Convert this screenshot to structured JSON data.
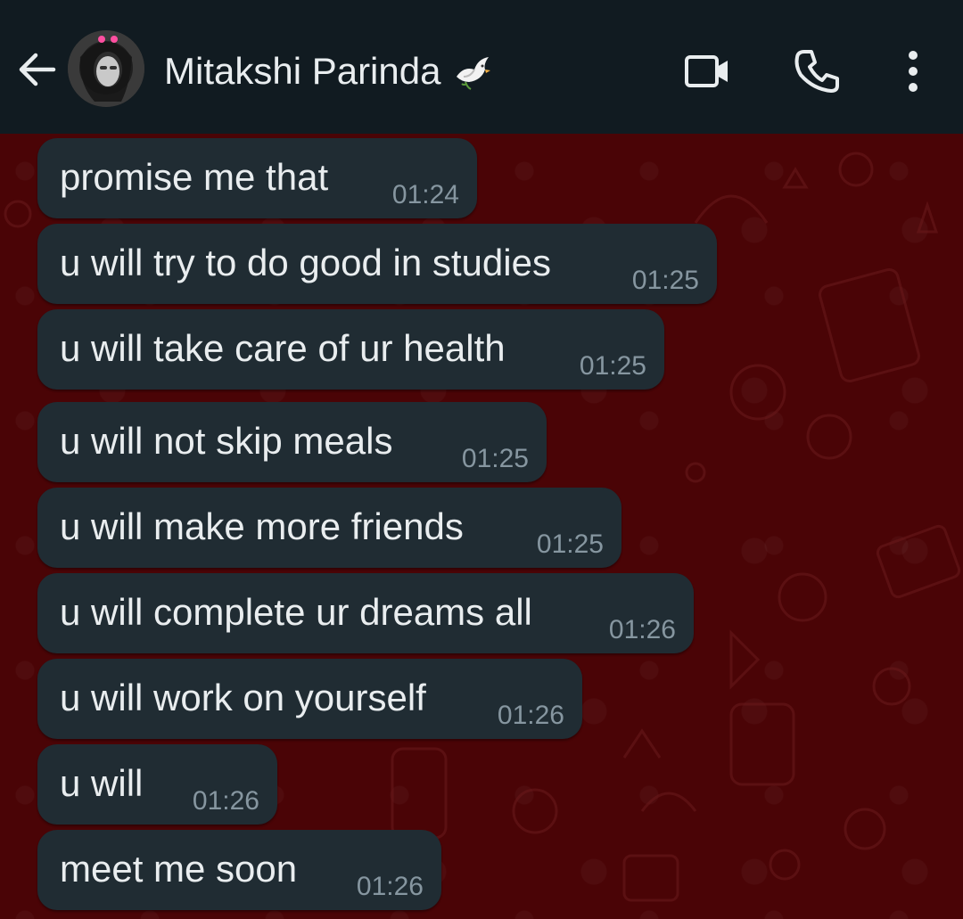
{
  "header": {
    "contact_name": "Mitakshi Parinda",
    "contact_emoji": "dove-emoji",
    "back_icon": "arrow-left-icon",
    "video_call_icon": "video-camera-icon",
    "voice_call_icon": "phone-icon",
    "menu_icon": "more-vertical-icon"
  },
  "messages": [
    {
      "text": "promise me that",
      "time": "01:24"
    },
    {
      "text": "u will try to do good in studies",
      "time": "01:25"
    },
    {
      "text": "u will take care of ur health",
      "time": "01:25"
    },
    {
      "text": "u will not skip meals",
      "time": "01:25"
    },
    {
      "text": "u will make more friends",
      "time": "01:25"
    },
    {
      "text": "u will complete ur dreams all",
      "time": "01:26"
    },
    {
      "text": "u will work on yourself",
      "time": "01:26"
    },
    {
      "text": "u will",
      "time": "01:26"
    },
    {
      "text": "meet me soon",
      "time": "01:26"
    }
  ],
  "colors": {
    "header_bg": "#111b21",
    "chat_bg": "#4a0406",
    "bubble_bg": "#202c33",
    "text": "#e9edef",
    "time": "#8696a0"
  }
}
